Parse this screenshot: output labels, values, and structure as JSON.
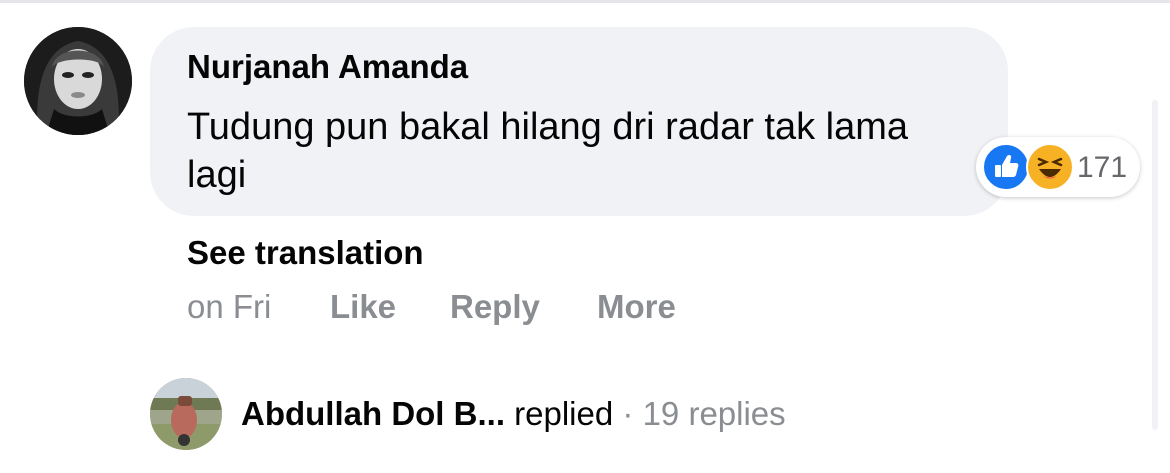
{
  "comment": {
    "author": "Nurjanah Amanda",
    "text": "Tudung pun bakal hilang dri radar tak lama lagi",
    "see_translation": "See translation",
    "timestamp": "on Fri",
    "actions": {
      "like": "Like",
      "reply": "Reply",
      "more": "More"
    },
    "reactions": {
      "types": [
        "like-icon",
        "haha-icon"
      ],
      "count": "171",
      "like_color": "#1877f2",
      "haha_color": "#f7b125"
    }
  },
  "replies": {
    "replier": "Abdullah Dol B...",
    "replied_word": "replied",
    "separator": "·",
    "count_text": "19 replies"
  },
  "colors": {
    "bubble_bg": "#f0f2f5",
    "secondary_text": "#8a8d91",
    "primary_text": "#050505"
  }
}
